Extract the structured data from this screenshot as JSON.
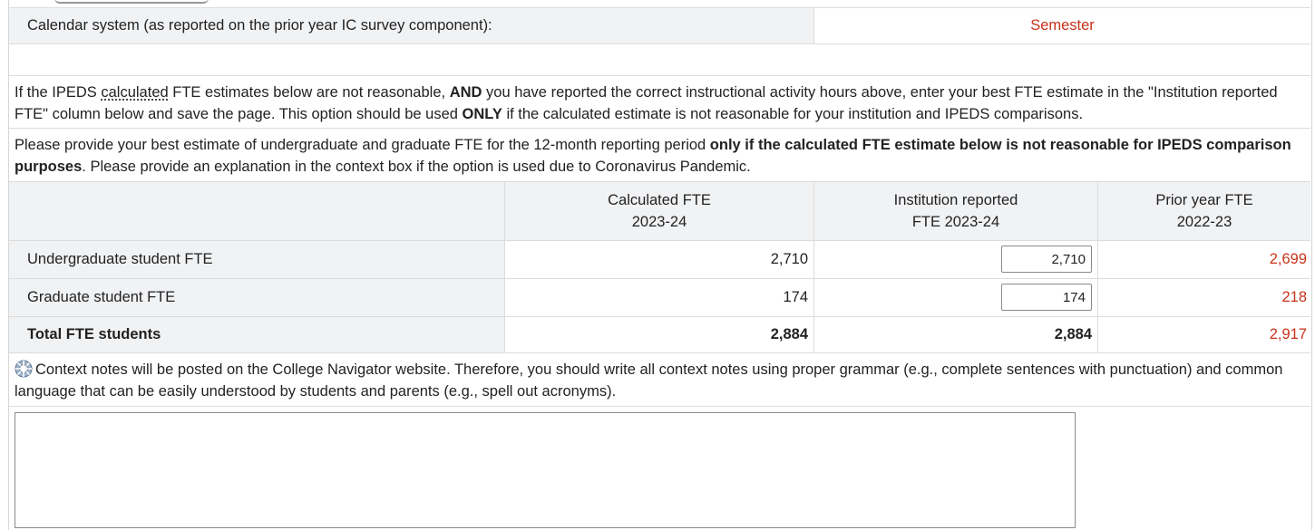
{
  "calendar": {
    "label": "Calendar system (as reported on the prior year IC survey component):",
    "value": "Semester"
  },
  "instructions": {
    "p1_a": "If the IPEDS ",
    "p1_calc": "calculated",
    "p1_b": " FTE estimates below are not reasonable, ",
    "p1_and": "AND",
    "p1_c": " you have reported the correct instructional activity hours above, enter your best FTE estimate in the \"Institution reported FTE\" column below and save the page. This option should be used ",
    "p1_only": "ONLY",
    "p1_d": " if the calculated estimate is not reasonable for your institution and IPEDS comparisons.",
    "p2_a": "Please provide your best estimate of undergraduate and graduate FTE for the 12-month reporting period ",
    "p2_bold": "only if the calculated FTE estimate below is not reasonable for IPEDS comparison purposes",
    "p2_b": ". Please provide an explanation in the context box if the option is used due to Coronavirus Pandemic."
  },
  "table": {
    "headers": {
      "calc_1": "Calculated FTE",
      "calc_2": "2023-24",
      "inst_1": "Institution reported",
      "inst_2": "FTE 2023-24",
      "prior_1": "Prior year FTE",
      "prior_2": "2022-23"
    },
    "rows": [
      {
        "label": "Undergraduate student FTE",
        "calc": "2,710",
        "inst": "2,710",
        "prior": "2,699"
      },
      {
        "label": "Graduate student FTE",
        "calc": "174",
        "inst": "174",
        "prior": "218"
      }
    ],
    "total": {
      "label": "Total FTE students",
      "calc": "2,884",
      "inst": "2,884",
      "prior": "2,917"
    }
  },
  "context": {
    "icon": "help-wheel-icon",
    "text": "Context notes will be posted on the College Navigator website. Therefore, you should write all context notes using proper grammar (e.g., complete sentences with punctuation) and common language that can be easily understood by students and parents (e.g., spell out acronyms).",
    "textarea_value": ""
  },
  "colors": {
    "accent_red": "#c8331a",
    "row_grey": "#f1f2f4"
  }
}
